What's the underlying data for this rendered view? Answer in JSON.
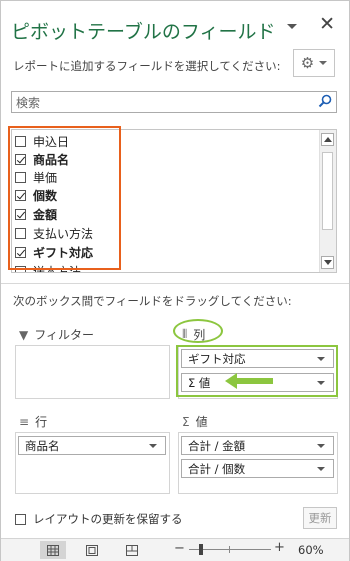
{
  "title": "ピボットテーブルのフィールド",
  "close_icon": "✕",
  "instruction": "レポートに追加するフィールドを選択してください:",
  "settings_icon": "gear-icon",
  "search": {
    "placeholder": "検索"
  },
  "fields": [
    {
      "label": "申込日",
      "checked": false
    },
    {
      "label": "商品名",
      "checked": true
    },
    {
      "label": "単価",
      "checked": false
    },
    {
      "label": "個数",
      "checked": true
    },
    {
      "label": "金額",
      "checked": true
    },
    {
      "label": "支払い方法",
      "checked": false
    },
    {
      "label": "ギフト対応",
      "checked": true
    },
    {
      "label": "送本方法",
      "checked": false
    }
  ],
  "drag_instruction": "次のボックス間でフィールドをドラッグしてください:",
  "areas": {
    "filter": {
      "label": "フィルター",
      "items": []
    },
    "columns": {
      "label": "列",
      "items": [
        "ギフト対応",
        "Σ 値"
      ]
    },
    "rows": {
      "label": "行",
      "items": [
        "商品名"
      ]
    },
    "values": {
      "label": "値",
      "items": [
        "合計 / 金額",
        "合計 / 個数"
      ]
    }
  },
  "annotation_colors": {
    "orange": "#e8601c",
    "green": "#8cc63f"
  },
  "defer_update_label": "レイアウトの更新を保留する",
  "update_button": "更新",
  "zoom_level": "60%",
  "zoom_minus": "−",
  "zoom_plus": "+"
}
